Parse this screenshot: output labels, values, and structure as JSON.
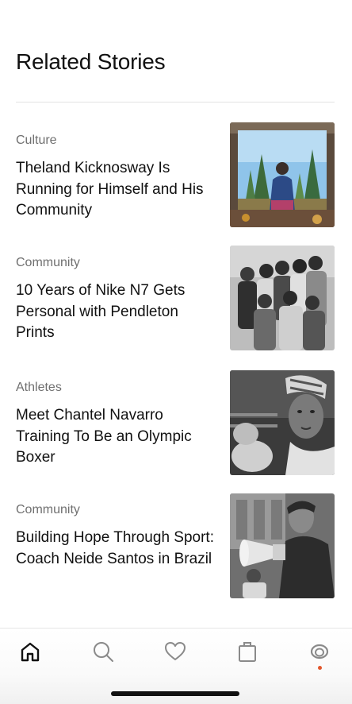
{
  "page": {
    "title": "Related Stories"
  },
  "stories": [
    {
      "category": "Culture",
      "title": "Theland Kicknosway Is Running for Himself and His Community",
      "image_icon": "forest-runner-photo"
    },
    {
      "category": "Community",
      "title": "10 Years of Nike N7 Gets Personal with Pendleton Prints",
      "image_icon": "group-portrait-photo"
    },
    {
      "category": "Athletes",
      "title": "Meet Chantel Navarro Training To Be an Olympic Boxer",
      "image_icon": "boxer-photo"
    },
    {
      "category": "Community",
      "title": "Building Hope Through Sport: Coach Neide Santos in Brazil",
      "image_icon": "coach-megaphone-photo"
    }
  ],
  "tabbar": {
    "items": [
      {
        "icon": "home-icon",
        "active": true
      },
      {
        "icon": "search-icon",
        "active": false
      },
      {
        "icon": "heart-icon",
        "active": false
      },
      {
        "icon": "bag-icon",
        "active": false
      },
      {
        "icon": "profile-icon",
        "active": false
      }
    ],
    "notification_color": "#e2572c"
  },
  "colors": {
    "text_primary": "#111111",
    "text_secondary": "#707070",
    "divider": "#e3e3e3"
  }
}
